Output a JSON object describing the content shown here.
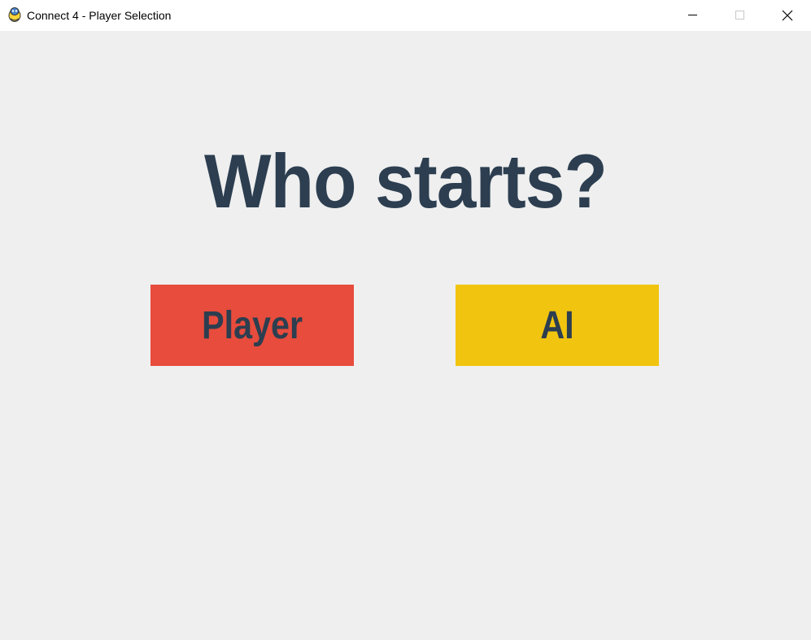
{
  "window": {
    "title": "Connect 4 - Player Selection",
    "icon": "pygame-snake-icon",
    "controls": {
      "minimize_icon": "minimize-icon",
      "maximize_icon": "maximize-icon",
      "close_icon": "close-icon"
    }
  },
  "screen": {
    "heading": "Who starts?",
    "options": [
      {
        "label": "Player",
        "color": "#e74c3c"
      },
      {
        "label": "AI",
        "color": "#f1c40f"
      }
    ],
    "text_color": "#2c3e50",
    "background_color": "#efefef"
  }
}
